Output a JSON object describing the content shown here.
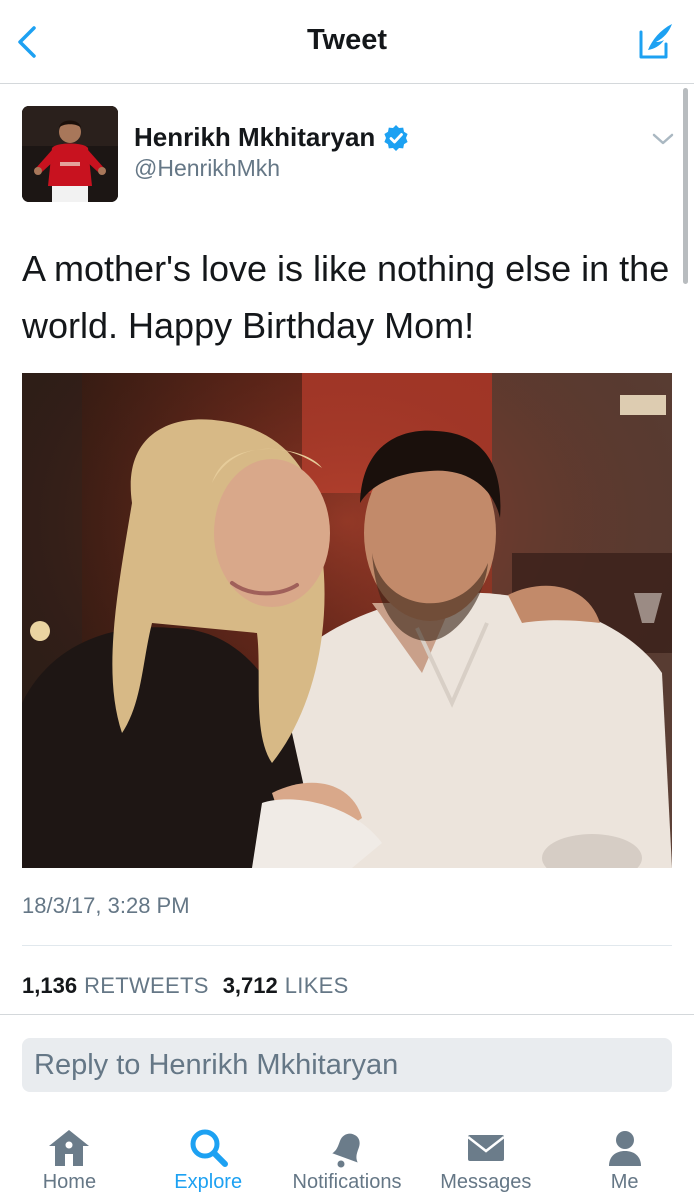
{
  "header": {
    "title": "Tweet",
    "back_icon": "chevron-left-icon",
    "compose_icon": "compose-tweet-icon"
  },
  "tweet": {
    "display_name": "Henrikh Mkhitaryan",
    "handle": "@HenrikhMkh",
    "verified": true,
    "text": "A mother's love is like nothing else in the world. Happy Birthday Mom!",
    "timestamp": "18/3/17, 3:28 PM",
    "retweets_count": "1,136",
    "retweets_label": "RETWEETS",
    "likes_count": "3,712",
    "likes_label": "LIKES"
  },
  "reply": {
    "placeholder": "Reply to Henrikh Mkhitaryan"
  },
  "tabbar": {
    "items": [
      {
        "label": "Home",
        "icon": "home-icon",
        "active": false
      },
      {
        "label": "Explore",
        "icon": "search-icon",
        "active": true
      },
      {
        "label": "Notifications",
        "icon": "bell-icon",
        "active": false
      },
      {
        "label": "Messages",
        "icon": "envelope-icon",
        "active": false
      },
      {
        "label": "Me",
        "icon": "person-icon",
        "active": false
      }
    ]
  },
  "colors": {
    "accent": "#1da1f2",
    "text": "#14171a",
    "secondary": "#657786",
    "tab_icon": "#6b7c8a",
    "reply_bg": "#e9ecef"
  }
}
